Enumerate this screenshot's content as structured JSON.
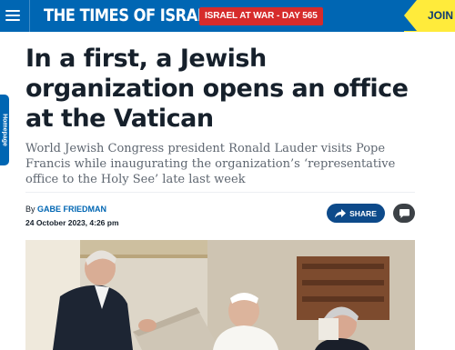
{
  "header": {
    "brand": "THE TIMES OF ISRAEL",
    "war_badge": "ISRAEL AT WAR - DAY 565",
    "join_label": "JOIN"
  },
  "side_tab": {
    "label": "Homepage"
  },
  "article": {
    "headline": "In a first, a Jewish organization opens an office at the Vatican",
    "subtitle": "World Jewish Congress president Ronald Lauder visits Pope Francis while inaugurating the organization’s ‘representative office to the Holy See’ late last week",
    "byline_prefix": "By",
    "author": "GABE FRIEDMAN",
    "date": "24 October 2023, 4:26 pm",
    "share_label": "SHARE"
  },
  "colors": {
    "brand_blue": "#0066b3",
    "badge_red": "#d62b2b",
    "join_yellow": "#ffeb3b",
    "share_navy": "#0d4a8a"
  },
  "icons": {
    "menu": "menu-icon",
    "share": "share-arrow-icon",
    "comment": "comment-icon"
  }
}
